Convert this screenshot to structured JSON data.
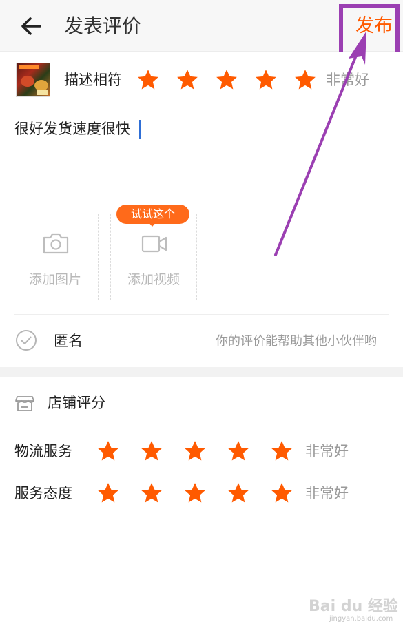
{
  "header": {
    "title": "发表评价",
    "publish_label": "发布"
  },
  "product_rating": {
    "label": "描述相符",
    "stars": 5,
    "max_stars": 5,
    "verdict": "非常好"
  },
  "comment": {
    "text": "很好发货速度很快"
  },
  "uploads": {
    "photo_label": "添加图片",
    "video_label": "添加视频",
    "video_badge": "试试这个"
  },
  "anonymous": {
    "label": "匿名",
    "hint": "你的评价能帮助其他小伙伴哟"
  },
  "shop_rating": {
    "title": "店铺评分",
    "items": [
      {
        "label": "物流服务",
        "stars": 5,
        "max_stars": 5,
        "verdict": "非常好"
      },
      {
        "label": "服务态度",
        "stars": 5,
        "max_stars": 5,
        "verdict": "非常好"
      }
    ]
  },
  "colors": {
    "accent": "#ff5a00",
    "star": "#ff5a00",
    "annotation": "#9b3fb2"
  },
  "watermark": {
    "brand": "Bai du 经验",
    "url": "jingyan.baidu.com"
  }
}
